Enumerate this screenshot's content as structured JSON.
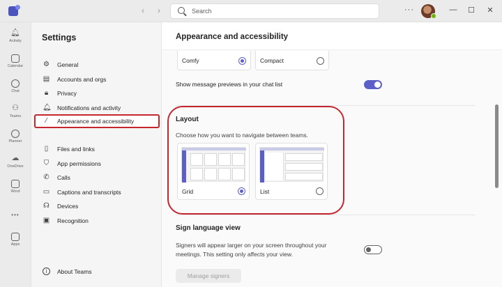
{
  "titlebar": {
    "back_icon": "‹",
    "forward_icon": "›",
    "search_placeholder": "Search",
    "more_icon": "···",
    "minimize_icon": "—",
    "maximize_icon": "☐",
    "close_icon": "✕"
  },
  "rail": {
    "items": [
      {
        "label": "Activity",
        "icon": "bell-icon"
      },
      {
        "label": "Calendar",
        "icon": "calendar-icon"
      },
      {
        "label": "Chat",
        "icon": "chat-icon"
      },
      {
        "label": "Teams",
        "icon": "teams-icon"
      },
      {
        "label": "Planner",
        "icon": "planner-icon"
      },
      {
        "label": "OneDrive",
        "icon": "cloud-icon"
      },
      {
        "label": "Word",
        "icon": "word-icon"
      },
      {
        "label": "Apps",
        "icon": "apps-icon"
      }
    ],
    "more_label": "•••"
  },
  "settings": {
    "title": "Settings",
    "menu": [
      {
        "label": "General",
        "icon": "gear-icon"
      },
      {
        "label": "Accounts and orgs",
        "icon": "id-card-icon"
      },
      {
        "label": "Privacy",
        "icon": "lock-icon"
      },
      {
        "label": "Notifications and activity",
        "icon": "bell-icon"
      },
      {
        "label": "Appearance and accessibility",
        "icon": "wand-icon",
        "selected": true
      },
      {
        "label": "Files and links",
        "icon": "file-icon"
      },
      {
        "label": "App permissions",
        "icon": "shield-icon"
      },
      {
        "label": "Calls",
        "icon": "phone-icon"
      },
      {
        "label": "Captions and transcripts",
        "icon": "captions-icon"
      },
      {
        "label": "Devices",
        "icon": "headset-icon"
      },
      {
        "label": "Recognition",
        "icon": "recognition-icon"
      }
    ],
    "about_label": "About Teams",
    "about_icon_text": "i"
  },
  "main": {
    "title": "Appearance and accessibility",
    "density": {
      "comfy_label": "Comfy",
      "compact_label": "Compact",
      "selected": "Comfy"
    },
    "message_previews": {
      "label": "Show message previews in your chat list",
      "on": true
    },
    "layout": {
      "title": "Layout",
      "description": "Choose how you want to navigate between teams.",
      "grid_label": "Grid",
      "list_label": "List",
      "selected": "Grid"
    },
    "sign_language": {
      "title": "Sign language view",
      "description": "Signers will appear larger on your screen throughout your meetings. This setting only affects your view.",
      "on": false,
      "button_label": "Manage signers"
    }
  },
  "colors": {
    "accent": "#5b5fc7",
    "highlight": "#c4262e"
  }
}
